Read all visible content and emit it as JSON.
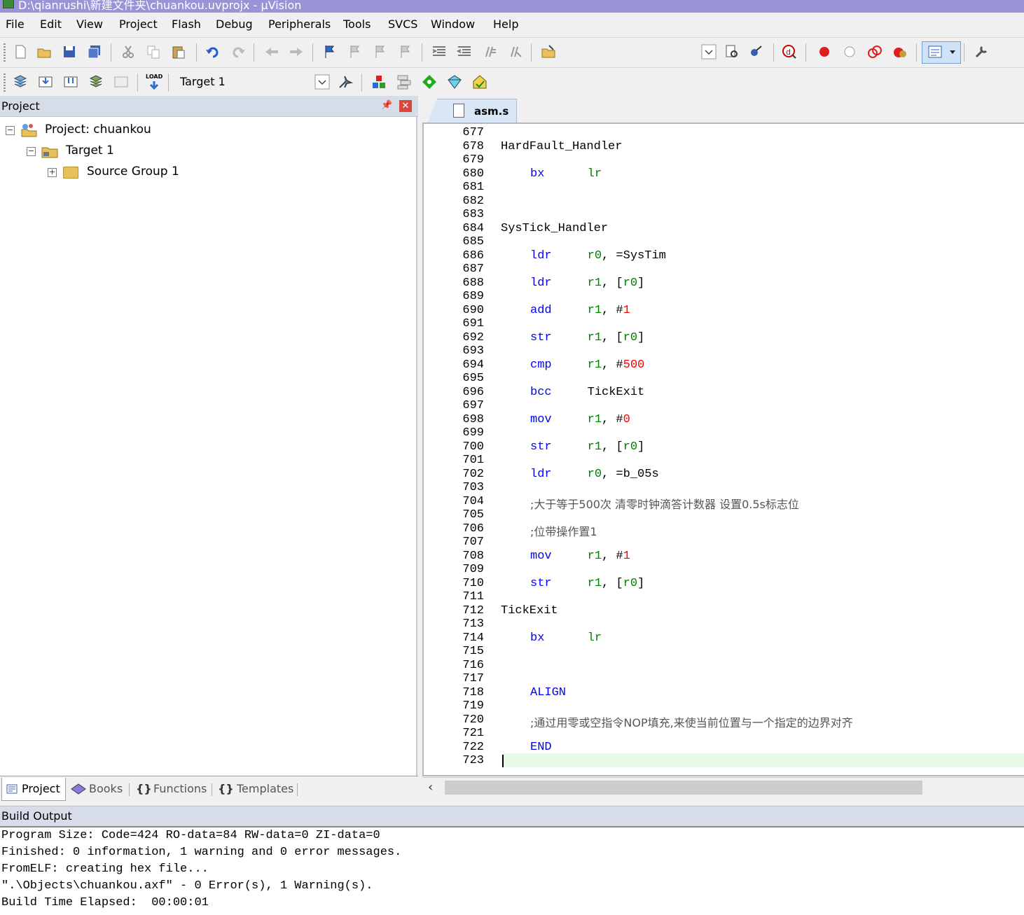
{
  "window": {
    "title": "D:\\qianrushi\\新建文件夹\\chuankou.uvprojx - µVision"
  },
  "menu": [
    "File",
    "Edit",
    "View",
    "Project",
    "Flash",
    "Debug",
    "Peripherals",
    "Tools",
    "SVCS",
    "Window",
    "Help"
  ],
  "toolbar2": {
    "target_value": "Target 1",
    "load_label": "LOAD"
  },
  "project_panel": {
    "title": "Project",
    "pin_icon": "📌",
    "close_icon": "✕",
    "tree": {
      "project": "Project: chuankou",
      "target": "Target 1",
      "group": "Source Group 1"
    },
    "tabs": [
      {
        "label": "Project",
        "icon": "project-icon"
      },
      {
        "label": "Books",
        "icon": "books-icon"
      },
      {
        "label": "Functions",
        "icon": "functions-icon"
      },
      {
        "label": "Templates",
        "icon": "templates-icon"
      }
    ]
  },
  "editor": {
    "tab": "asm.s",
    "lines": [
      {
        "n": "677",
        "t": []
      },
      {
        "n": "678",
        "t": [
          [
            "plain",
            "HardFault_Handler"
          ]
        ],
        "i": 0
      },
      {
        "n": "679",
        "t": []
      },
      {
        "n": "680",
        "t": [
          [
            "kw",
            "bx"
          ],
          [
            "reg",
            "      lr"
          ]
        ],
        "i": 1
      },
      {
        "n": "681",
        "t": []
      },
      {
        "n": "682",
        "t": []
      },
      {
        "n": "683",
        "t": []
      },
      {
        "n": "684",
        "t": [
          [
            "plain",
            "SysTick_Handler"
          ]
        ],
        "i": 0
      },
      {
        "n": "685",
        "t": []
      },
      {
        "n": "686",
        "t": [
          [
            "kw",
            "ldr"
          ],
          [
            "reg",
            "     r0"
          ],
          [
            "plain",
            ", =SysTim"
          ]
        ],
        "i": 1
      },
      {
        "n": "687",
        "t": []
      },
      {
        "n": "688",
        "t": [
          [
            "kw",
            "ldr"
          ],
          [
            "reg",
            "     r1"
          ],
          [
            "plain",
            ", ["
          ],
          [
            "reg",
            "r0"
          ],
          [
            "plain",
            "]"
          ]
        ],
        "i": 1
      },
      {
        "n": "689",
        "t": []
      },
      {
        "n": "690",
        "t": [
          [
            "kw",
            "add"
          ],
          [
            "reg",
            "     r1"
          ],
          [
            "plain",
            ", #"
          ],
          [
            "num",
            "1"
          ]
        ],
        "i": 1
      },
      {
        "n": "691",
        "t": []
      },
      {
        "n": "692",
        "t": [
          [
            "kw",
            "str"
          ],
          [
            "reg",
            "     r1"
          ],
          [
            "plain",
            ", ["
          ],
          [
            "reg",
            "r0"
          ],
          [
            "plain",
            "]"
          ]
        ],
        "i": 1
      },
      {
        "n": "693",
        "t": []
      },
      {
        "n": "694",
        "t": [
          [
            "kw",
            "cmp"
          ],
          [
            "reg",
            "     r1"
          ],
          [
            "plain",
            ", #"
          ],
          [
            "num",
            "500"
          ]
        ],
        "i": 1
      },
      {
        "n": "695",
        "t": []
      },
      {
        "n": "696",
        "t": [
          [
            "kw",
            "bcc"
          ],
          [
            "plain",
            "     TickExit"
          ]
        ],
        "i": 1
      },
      {
        "n": "697",
        "t": []
      },
      {
        "n": "698",
        "t": [
          [
            "kw",
            "mov"
          ],
          [
            "reg",
            "     r1"
          ],
          [
            "plain",
            ", #"
          ],
          [
            "num",
            "0"
          ]
        ],
        "i": 1
      },
      {
        "n": "699",
        "t": []
      },
      {
        "n": "700",
        "t": [
          [
            "kw",
            "str"
          ],
          [
            "reg",
            "     r1"
          ],
          [
            "plain",
            ", ["
          ],
          [
            "reg",
            "r0"
          ],
          [
            "plain",
            "]"
          ]
        ],
        "i": 1
      },
      {
        "n": "701",
        "t": []
      },
      {
        "n": "702",
        "t": [
          [
            "kw",
            "ldr"
          ],
          [
            "reg",
            "     r0"
          ],
          [
            "plain",
            ", =b_05s"
          ]
        ],
        "i": 1
      },
      {
        "n": "703",
        "t": []
      },
      {
        "n": "704",
        "t": [
          [
            "cmt",
            ";大于等于500次 清零时钟滴答计数器 设置0.5s标志位"
          ]
        ],
        "i": 1
      },
      {
        "n": "705",
        "t": []
      },
      {
        "n": "706",
        "t": [
          [
            "cmt",
            ";位带操作置1"
          ]
        ],
        "i": 1
      },
      {
        "n": "707",
        "t": []
      },
      {
        "n": "708",
        "t": [
          [
            "kw",
            "mov"
          ],
          [
            "reg",
            "     r1"
          ],
          [
            "plain",
            ", #"
          ],
          [
            "num",
            "1"
          ]
        ],
        "i": 1
      },
      {
        "n": "709",
        "t": []
      },
      {
        "n": "710",
        "t": [
          [
            "kw",
            "str"
          ],
          [
            "reg",
            "     r1"
          ],
          [
            "plain",
            ", ["
          ],
          [
            "reg",
            "r0"
          ],
          [
            "plain",
            "]"
          ]
        ],
        "i": 1
      },
      {
        "n": "711",
        "t": []
      },
      {
        "n": "712",
        "t": [
          [
            "plain",
            "TickExit"
          ]
        ],
        "i": 0
      },
      {
        "n": "713",
        "t": []
      },
      {
        "n": "714",
        "t": [
          [
            "kw",
            "bx"
          ],
          [
            "reg",
            "      lr"
          ]
        ],
        "i": 1
      },
      {
        "n": "715",
        "t": []
      },
      {
        "n": "716",
        "t": []
      },
      {
        "n": "717",
        "t": []
      },
      {
        "n": "718",
        "t": [
          [
            "kw",
            "ALIGN"
          ]
        ],
        "i": 1
      },
      {
        "n": "719",
        "t": []
      },
      {
        "n": "720",
        "t": [
          [
            "cmt",
            ";通过用零或空指令NOP填充,来使当前位置与一个指定的边界对齐"
          ]
        ],
        "i": 1
      },
      {
        "n": "721",
        "t": []
      },
      {
        "n": "722",
        "t": [
          [
            "kw",
            "END"
          ]
        ],
        "i": 1
      },
      {
        "n": "723",
        "t": []
      }
    ]
  },
  "build_output": {
    "title": "Build Output",
    "lines": [
      "Program Size: Code=424 RO-data=84 RW-data=0 ZI-data=0",
      "Finished: 0 information, 1 warning and 0 error messages.",
      "FromELF: creating hex file...",
      "\".\\Objects\\chuankou.axf\" - 0 Error(s), 1 Warning(s).",
      "Build Time Elapsed:  00:00:01"
    ]
  },
  "colors": {
    "keyword": "#0000ff",
    "register": "#008000",
    "number": "#ff0000",
    "panel_header": "#d7dde8",
    "current_line": "#e6fae6"
  }
}
